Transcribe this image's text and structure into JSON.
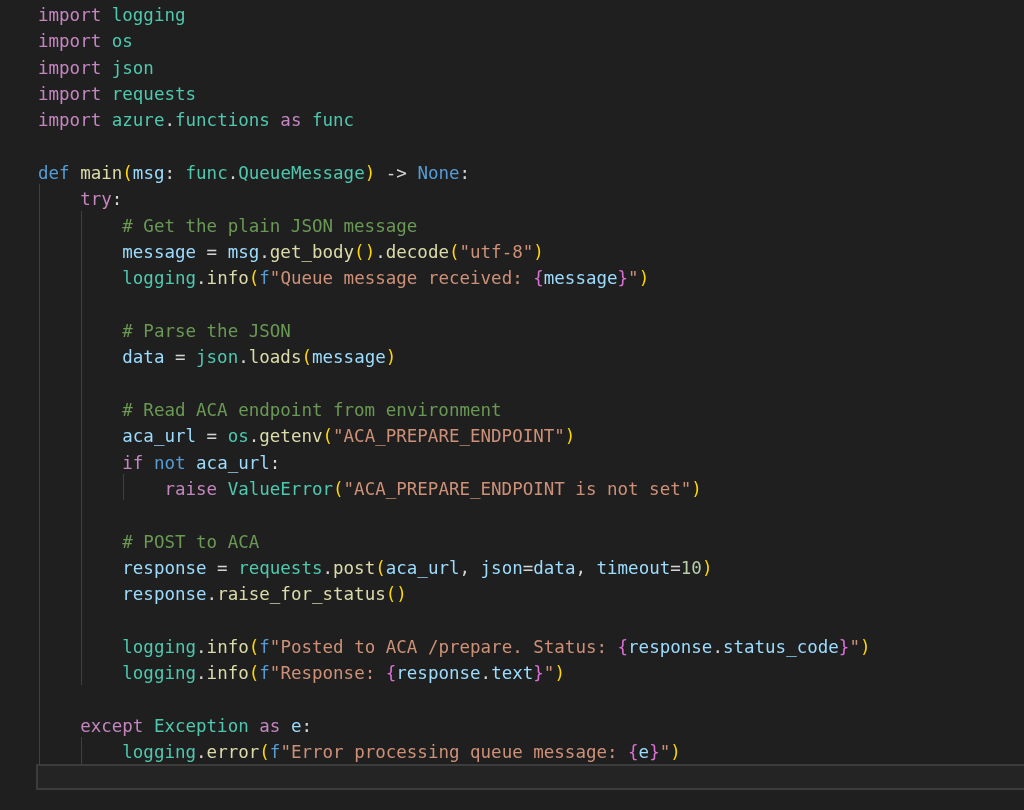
{
  "editor": {
    "lines": [
      {
        "current": false,
        "tokens": [
          {
            "kind": "kw",
            "text": "import "
          },
          {
            "kind": "mod",
            "text": "logging"
          }
        ]
      },
      {
        "current": false,
        "tokens": [
          {
            "kind": "kw",
            "text": "import "
          },
          {
            "kind": "mod",
            "text": "os"
          }
        ]
      },
      {
        "current": false,
        "tokens": [
          {
            "kind": "kw",
            "text": "import "
          },
          {
            "kind": "mod",
            "text": "json"
          }
        ]
      },
      {
        "current": false,
        "tokens": [
          {
            "kind": "kw",
            "text": "import "
          },
          {
            "kind": "mod",
            "text": "requests"
          }
        ]
      },
      {
        "current": false,
        "tokens": [
          {
            "kind": "kw",
            "text": "import "
          },
          {
            "kind": "mod",
            "text": "azure"
          },
          {
            "kind": "punc",
            "text": "."
          },
          {
            "kind": "mod",
            "text": "functions "
          },
          {
            "kind": "kw",
            "text": "as "
          },
          {
            "kind": "mod",
            "text": "func"
          }
        ]
      },
      {
        "current": false
      },
      {
        "current": false,
        "tokens": [
          {
            "kind": "kw2",
            "text": "def "
          },
          {
            "kind": "fn",
            "text": "main"
          },
          {
            "kind": "br1",
            "text": "("
          },
          {
            "kind": "var",
            "text": "msg"
          },
          {
            "kind": "punc",
            "text": ": "
          },
          {
            "kind": "mod",
            "text": "func"
          },
          {
            "kind": "punc",
            "text": "."
          },
          {
            "kind": "mod",
            "text": "QueueMessage"
          },
          {
            "kind": "br1",
            "text": ")"
          },
          {
            "kind": "punc",
            "text": " -> "
          },
          {
            "kind": "kw2",
            "text": "None"
          },
          {
            "kind": "punc",
            "text": ":"
          }
        ]
      },
      {
        "current": false,
        "tokens": [
          {
            "kind": "kw",
            "text": "    try"
          },
          {
            "kind": "punc",
            "text": ":"
          }
        ]
      },
      {
        "current": false,
        "tokens": [
          {
            "kind": "com",
            "text": "        # Get the plain JSON message"
          }
        ]
      },
      {
        "current": false,
        "tokens": [
          {
            "kind": "var",
            "text": "        message"
          },
          {
            "kind": "punc",
            "text": " = "
          },
          {
            "kind": "var",
            "text": "msg"
          },
          {
            "kind": "punc",
            "text": "."
          },
          {
            "kind": "fn",
            "text": "get_body"
          },
          {
            "kind": "br1",
            "text": "()"
          },
          {
            "kind": "punc",
            "text": "."
          },
          {
            "kind": "fn",
            "text": "decode"
          },
          {
            "kind": "br1",
            "text": "("
          },
          {
            "kind": "str",
            "text": "\"utf-8\""
          },
          {
            "kind": "br1",
            "text": ")"
          }
        ]
      },
      {
        "current": false,
        "tokens": [
          {
            "kind": "mod",
            "text": "        logging"
          },
          {
            "kind": "punc",
            "text": "."
          },
          {
            "kind": "fn",
            "text": "info"
          },
          {
            "kind": "br1",
            "text": "("
          },
          {
            "kind": "kw2",
            "text": "f"
          },
          {
            "kind": "str",
            "text": "\"Queue message received: "
          },
          {
            "kind": "br2",
            "text": "{"
          },
          {
            "kind": "var",
            "text": "message"
          },
          {
            "kind": "br2",
            "text": "}"
          },
          {
            "kind": "str",
            "text": "\""
          },
          {
            "kind": "br1",
            "text": ")"
          }
        ]
      },
      {
        "current": false
      },
      {
        "current": false,
        "tokens": [
          {
            "kind": "com",
            "text": "        # Parse the JSON"
          }
        ]
      },
      {
        "current": false,
        "tokens": [
          {
            "kind": "var",
            "text": "        data"
          },
          {
            "kind": "punc",
            "text": " = "
          },
          {
            "kind": "mod",
            "text": "json"
          },
          {
            "kind": "punc",
            "text": "."
          },
          {
            "kind": "fn",
            "text": "loads"
          },
          {
            "kind": "br1",
            "text": "("
          },
          {
            "kind": "var",
            "text": "message"
          },
          {
            "kind": "br1",
            "text": ")"
          }
        ]
      },
      {
        "current": false
      },
      {
        "current": false,
        "tokens": [
          {
            "kind": "com",
            "text": "        # Read ACA endpoint from environment"
          }
        ]
      },
      {
        "current": false,
        "tokens": [
          {
            "kind": "var",
            "text": "        aca_url"
          },
          {
            "kind": "punc",
            "text": " = "
          },
          {
            "kind": "mod",
            "text": "os"
          },
          {
            "kind": "punc",
            "text": "."
          },
          {
            "kind": "fn",
            "text": "getenv"
          },
          {
            "kind": "br1",
            "text": "("
          },
          {
            "kind": "str",
            "text": "\"ACA_PREPARE_ENDPOINT\""
          },
          {
            "kind": "br1",
            "text": ")"
          }
        ]
      },
      {
        "current": false,
        "tokens": [
          {
            "kind": "kw",
            "text": "        if "
          },
          {
            "kind": "kw2",
            "text": "not "
          },
          {
            "kind": "var",
            "text": "aca_url"
          },
          {
            "kind": "punc",
            "text": ":"
          }
        ]
      },
      {
        "current": false,
        "tokens": [
          {
            "kind": "kw",
            "text": "            raise "
          },
          {
            "kind": "mod",
            "text": "ValueError"
          },
          {
            "kind": "br1",
            "text": "("
          },
          {
            "kind": "str",
            "text": "\"ACA_PREPARE_ENDPOINT is not set\""
          },
          {
            "kind": "br1",
            "text": ")"
          }
        ]
      },
      {
        "current": false
      },
      {
        "current": false,
        "tokens": [
          {
            "kind": "com",
            "text": "        # POST to ACA"
          }
        ]
      },
      {
        "current": false,
        "tokens": [
          {
            "kind": "var",
            "text": "        response"
          },
          {
            "kind": "punc",
            "text": " = "
          },
          {
            "kind": "mod",
            "text": "requests"
          },
          {
            "kind": "punc",
            "text": "."
          },
          {
            "kind": "fn",
            "text": "post"
          },
          {
            "kind": "br1",
            "text": "("
          },
          {
            "kind": "var",
            "text": "aca_url"
          },
          {
            "kind": "punc",
            "text": ", "
          },
          {
            "kind": "var",
            "text": "json"
          },
          {
            "kind": "punc",
            "text": "="
          },
          {
            "kind": "var",
            "text": "data"
          },
          {
            "kind": "punc",
            "text": ", "
          },
          {
            "kind": "var",
            "text": "timeout"
          },
          {
            "kind": "punc",
            "text": "="
          },
          {
            "kind": "num",
            "text": "10"
          },
          {
            "kind": "br1",
            "text": ")"
          }
        ]
      },
      {
        "current": false,
        "tokens": [
          {
            "kind": "var",
            "text": "        response"
          },
          {
            "kind": "punc",
            "text": "."
          },
          {
            "kind": "fn",
            "text": "raise_for_status"
          },
          {
            "kind": "br1",
            "text": "()"
          }
        ]
      },
      {
        "current": false
      },
      {
        "current": false,
        "tokens": [
          {
            "kind": "mod",
            "text": "        logging"
          },
          {
            "kind": "punc",
            "text": "."
          },
          {
            "kind": "fn",
            "text": "info"
          },
          {
            "kind": "br1",
            "text": "("
          },
          {
            "kind": "kw2",
            "text": "f"
          },
          {
            "kind": "str",
            "text": "\"Posted to ACA /prepare. Status: "
          },
          {
            "kind": "br2",
            "text": "{"
          },
          {
            "kind": "var",
            "text": "response"
          },
          {
            "kind": "punc",
            "text": "."
          },
          {
            "kind": "var",
            "text": "status_code"
          },
          {
            "kind": "br2",
            "text": "}"
          },
          {
            "kind": "str",
            "text": "\""
          },
          {
            "kind": "br1",
            "text": ")"
          }
        ]
      },
      {
        "current": false,
        "tokens": [
          {
            "kind": "mod",
            "text": "        logging"
          },
          {
            "kind": "punc",
            "text": "."
          },
          {
            "kind": "fn",
            "text": "info"
          },
          {
            "kind": "br1",
            "text": "("
          },
          {
            "kind": "kw2",
            "text": "f"
          },
          {
            "kind": "str",
            "text": "\"Response: "
          },
          {
            "kind": "br2",
            "text": "{"
          },
          {
            "kind": "var",
            "text": "response"
          },
          {
            "kind": "punc",
            "text": "."
          },
          {
            "kind": "var",
            "text": "text"
          },
          {
            "kind": "br2",
            "text": "}"
          },
          {
            "kind": "str",
            "text": "\""
          },
          {
            "kind": "br1",
            "text": ")"
          }
        ]
      },
      {
        "current": false
      },
      {
        "current": false,
        "tokens": [
          {
            "kind": "kw",
            "text": "    except "
          },
          {
            "kind": "mod",
            "text": "Exception "
          },
          {
            "kind": "kw",
            "text": "as "
          },
          {
            "kind": "var",
            "text": "e"
          },
          {
            "kind": "punc",
            "text": ":"
          }
        ]
      },
      {
        "current": false,
        "tokens": [
          {
            "kind": "mod",
            "text": "        logging"
          },
          {
            "kind": "punc",
            "text": "."
          },
          {
            "kind": "fn",
            "text": "error"
          },
          {
            "kind": "br1",
            "text": "("
          },
          {
            "kind": "kw2",
            "text": "f"
          },
          {
            "kind": "str",
            "text": "\"Error processing queue message: "
          },
          {
            "kind": "br2",
            "text": "{"
          },
          {
            "kind": "var",
            "text": "e"
          },
          {
            "kind": "br2",
            "text": "}"
          },
          {
            "kind": "str",
            "text": "\""
          },
          {
            "kind": "br1",
            "text": ")"
          }
        ]
      },
      {
        "current": true
      }
    ]
  }
}
